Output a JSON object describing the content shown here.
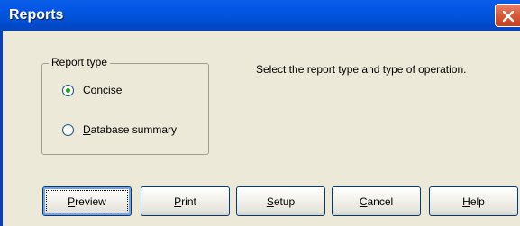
{
  "window": {
    "title": "Reports",
    "close_icon": "close-icon",
    "colors": {
      "titlebar": "#0154dc",
      "close": "#d95b3a",
      "face": "#ece9d8"
    }
  },
  "report_type": {
    "legend": "Report type",
    "options": [
      {
        "label_pre": "Co",
        "label_accel": "n",
        "label_post": "cise",
        "selected": true
      },
      {
        "label_pre": "",
        "label_accel": "D",
        "label_post": "atabase summary",
        "selected": false
      }
    ]
  },
  "instruction": "Select the report type and type of operation.",
  "buttons": {
    "preview": {
      "pre": "",
      "accel": "P",
      "post": "review"
    },
    "print": {
      "pre": "",
      "accel": "P",
      "post": "rint"
    },
    "setup": {
      "pre": "",
      "accel": "S",
      "post": "etup"
    },
    "cancel": {
      "pre": "",
      "accel": "C",
      "post": "ancel"
    },
    "help": {
      "pre": "",
      "accel": "H",
      "post": "elp"
    }
  }
}
